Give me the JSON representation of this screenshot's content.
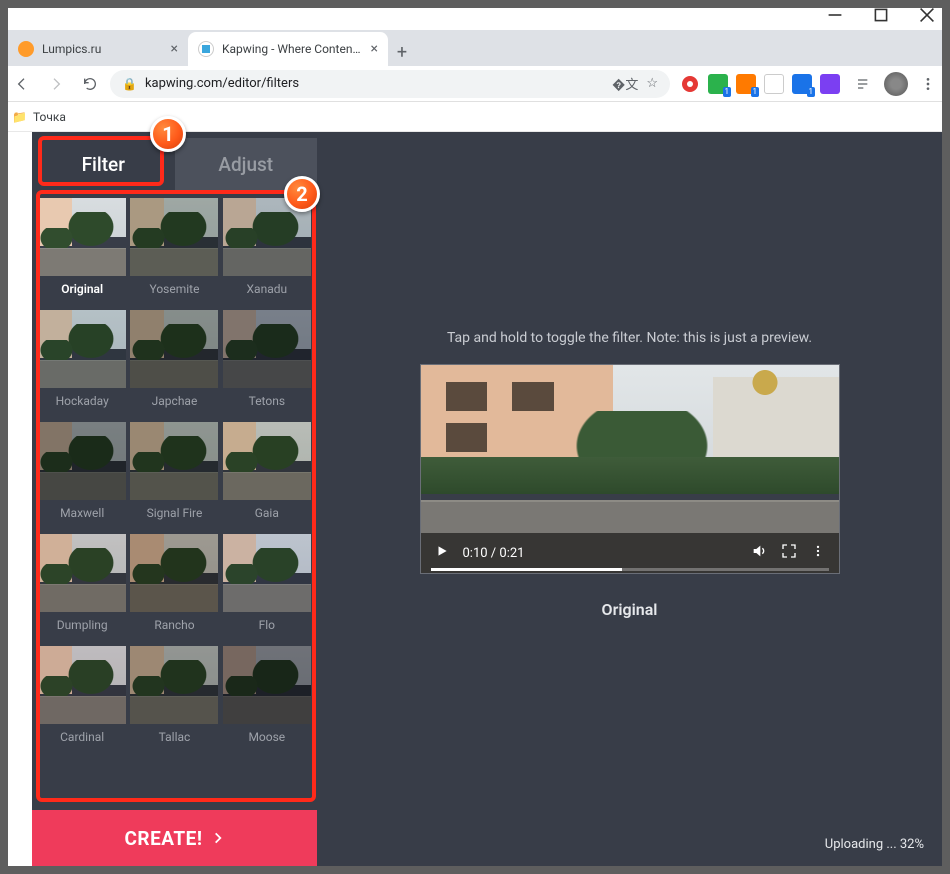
{
  "window": {
    "tabs": [
      {
        "title": "Lumpics.ru",
        "favicon_color": "#ff9b2a"
      },
      {
        "title": "Kapwing - Where Content Creati...",
        "favicon_color": "#3aa6dd"
      }
    ]
  },
  "browser": {
    "url": "kapwing.com/editor/filters",
    "bookmark": "Точка",
    "translate_icon": "translate-icon",
    "star_icon": "star-icon",
    "extensions": [
      {
        "name": "ext-adblock",
        "color": "#e53935",
        "badge": ""
      },
      {
        "name": "ext-green",
        "color": "#2bb24c",
        "badge": "1"
      },
      {
        "name": "ext-orange",
        "color": "#ff7a00",
        "badge": "1"
      },
      {
        "name": "ext-white",
        "color": "#ffffff",
        "badge": ""
      },
      {
        "name": "ext-blue",
        "color": "#1a73e8",
        "badge": "1"
      },
      {
        "name": "ext-purple",
        "color": "#7b3ff2",
        "badge": ""
      }
    ],
    "reading_list_icon": "reading-list",
    "menu_icon": "kebab"
  },
  "app": {
    "tabs": {
      "filter": "Filter",
      "adjust": "Adjust"
    },
    "filters": [
      [
        "Original",
        "Yosemite",
        "Xanadu"
      ],
      [
        "Hockaday",
        "Japchae",
        "Tetons"
      ],
      [
        "Maxwell",
        "Signal Fire",
        "Gaia"
      ],
      [
        "Dumpling",
        "Rancho",
        "Flo"
      ],
      [
        "Cardinal",
        "Tallac",
        "Moose"
      ]
    ],
    "filter_tints": {
      "Original": "rgba(0,0,0,0)",
      "Yosemite": "rgba(60,80,60,0.35)",
      "Xanadu": "rgba(120,140,150,0.38)",
      "Hockaday": "rgba(120,150,160,0.30)",
      "Japchae": "rgba(40,50,40,0.45)",
      "Tetons": "rgba(30,40,60,0.50)",
      "Maxwell": "rgba(20,30,30,0.48)",
      "Signal Fire": "rgba(50,60,40,0.42)",
      "Gaia": "rgba(150,150,120,0.35)",
      "Dumpling": "rgba(160,140,130,0.28)",
      "Rancho": "rgba(90,70,40,0.42)",
      "Flo": "rgba(150,160,190,0.30)",
      "Cardinal": "rgba(150,120,120,0.28)",
      "Tallac": "rgba(60,60,45,0.42)",
      "Moose": "rgba(30,30,40,0.55)"
    },
    "selected_filter": "Original",
    "create_label": "CREATE!",
    "preview_hint": "Tap and hold to toggle the filter. Note: this is just a preview.",
    "preview_label": "Original",
    "video": {
      "current": "0:10",
      "total": "0:21",
      "progress_pct": 48
    },
    "upload_status": "Uploading ... 32%"
  },
  "annotations": {
    "marker1": "1",
    "marker2": "2"
  }
}
